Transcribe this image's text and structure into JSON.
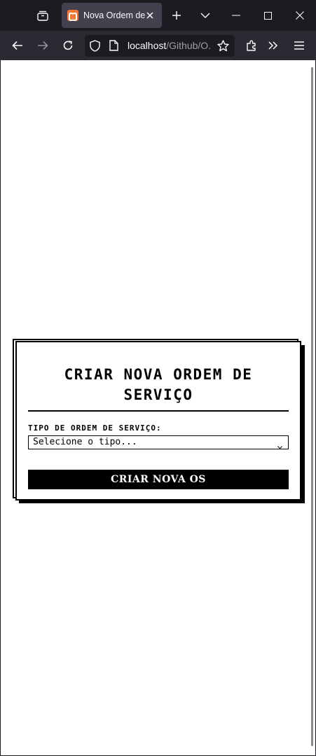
{
  "browser": {
    "tab_title": "Nova Ordem de Serviço",
    "url_host": "localhost",
    "url_path": "/Github/O..."
  },
  "form": {
    "title": "CRIAR NOVA ORDEM DE SERVIÇO",
    "type_label": "TIPO DE ORDEM DE SERVIÇO:",
    "type_select_value": "Selecione o tipo...",
    "submit_label": "CRIAR NOVA OS"
  },
  "icons": {
    "tab_favicon": "xampp-icon",
    "collections": "tab-collections-icon"
  }
}
